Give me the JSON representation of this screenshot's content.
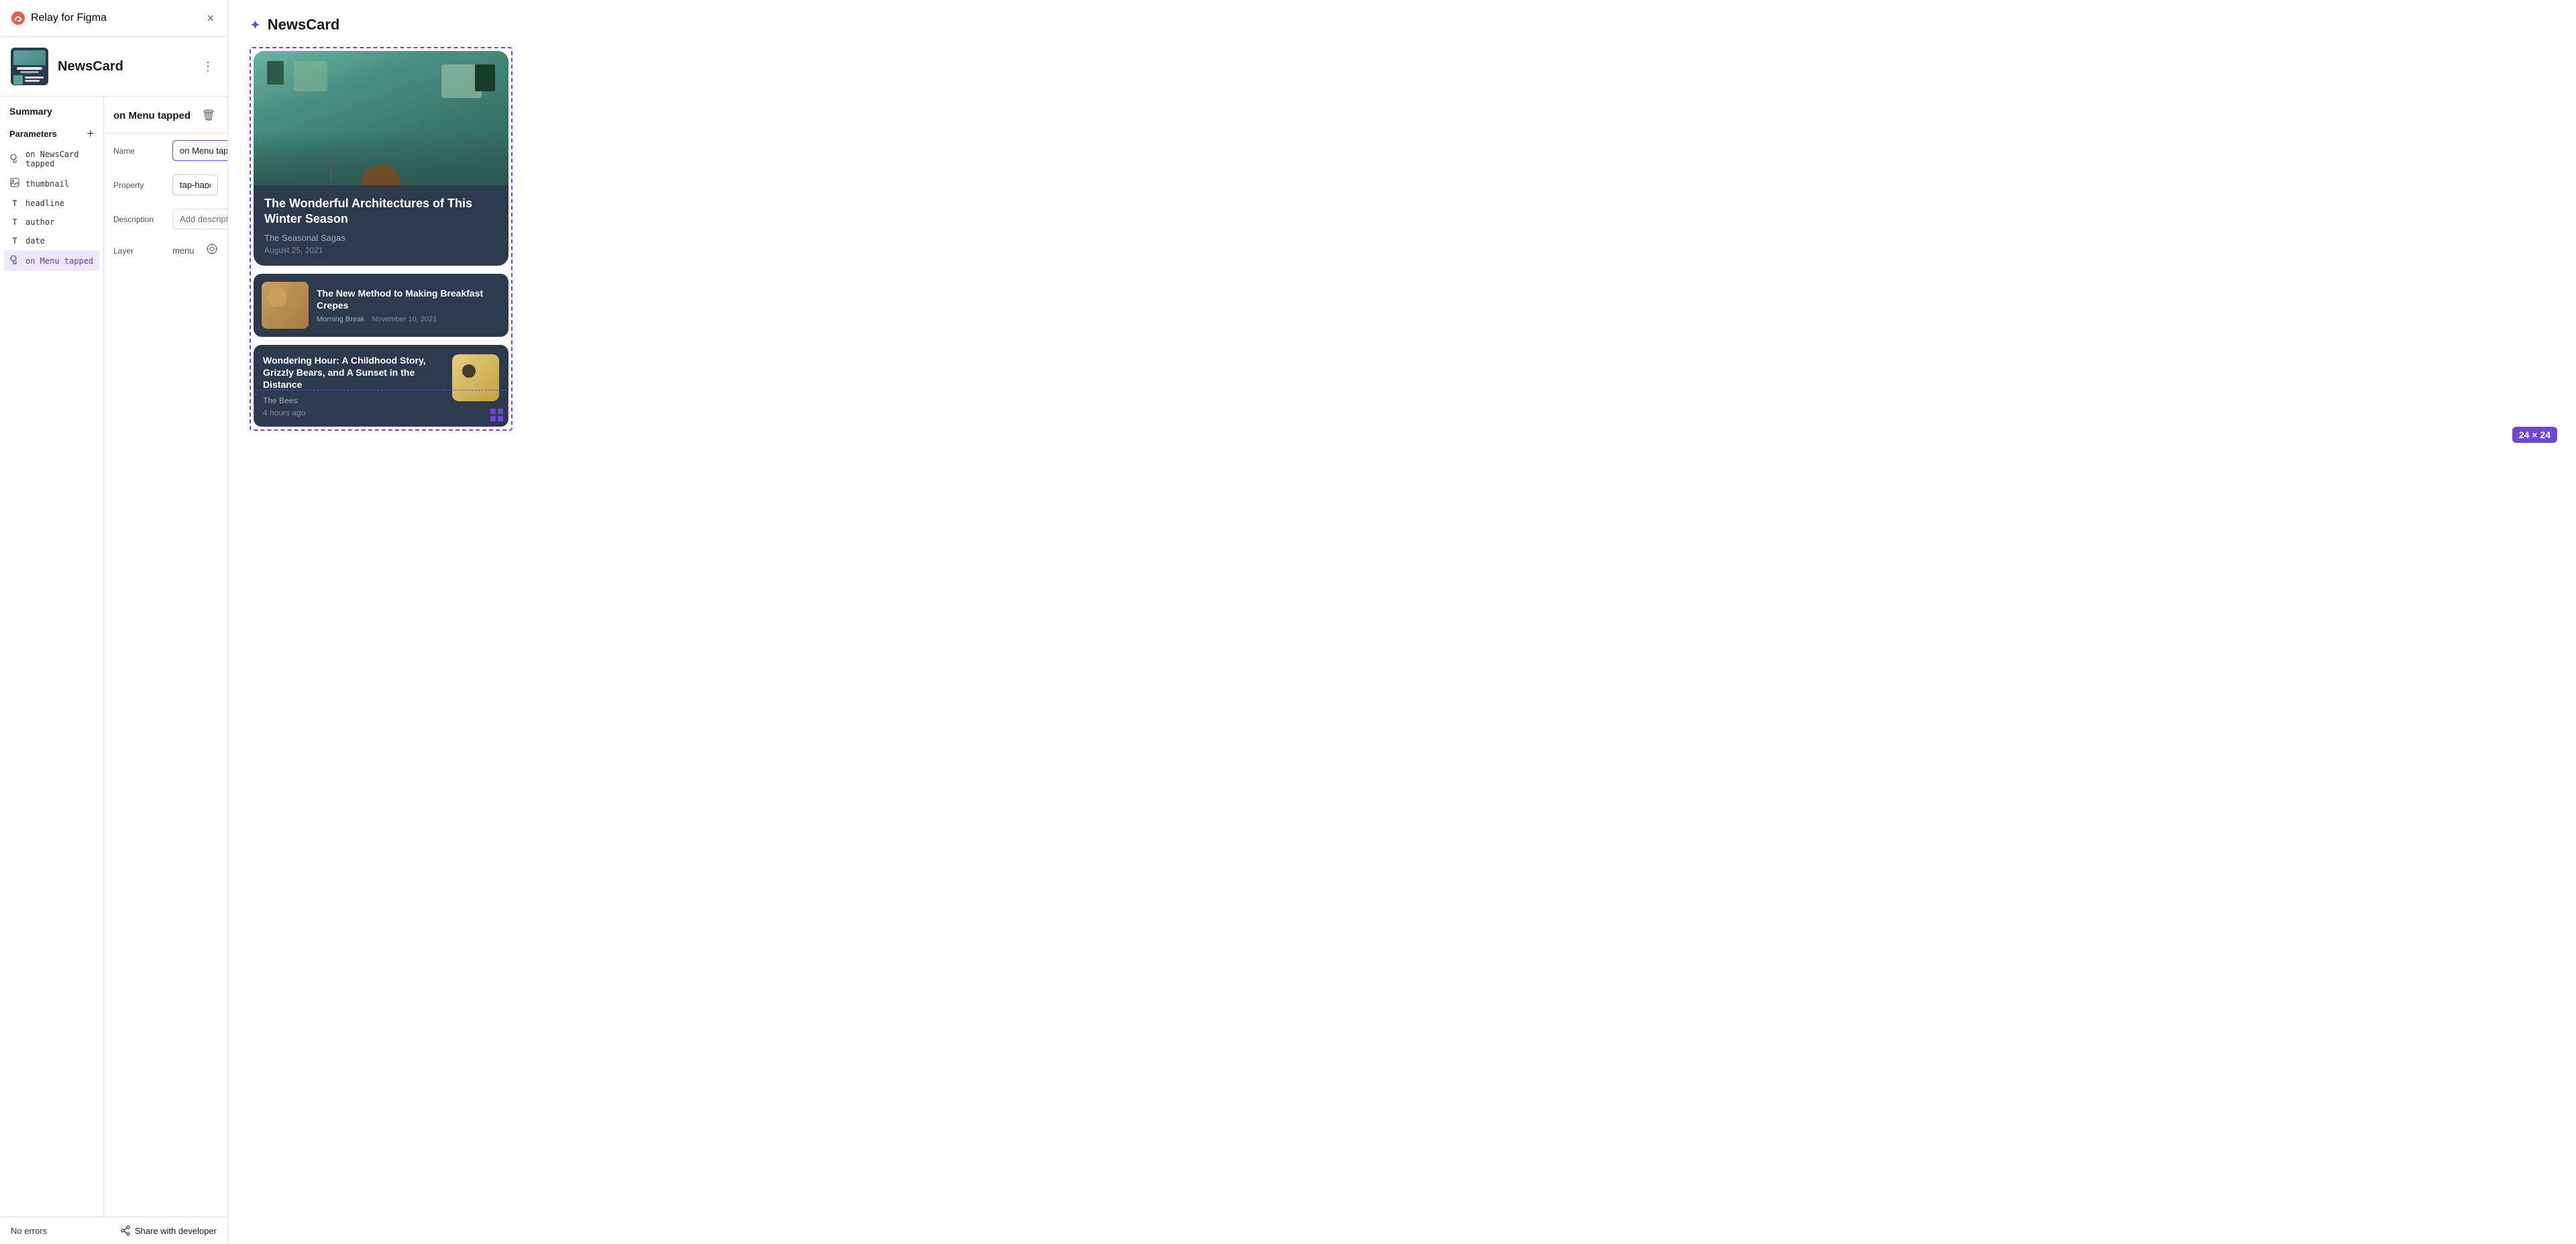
{
  "app": {
    "name": "Relay for Figma",
    "close_label": "×"
  },
  "component": {
    "title": "NewsCard",
    "more_label": "⋮"
  },
  "summary": {
    "title": "Summary",
    "parameters_label": "Parameters",
    "add_label": "+",
    "params": [
      {
        "id": "on-newscard-tapped",
        "icon": "tap",
        "name": "on NewsCard tapped",
        "active": false
      },
      {
        "id": "thumbnail",
        "icon": "image",
        "name": "thumbnail",
        "active": false
      },
      {
        "id": "headline",
        "icon": "text",
        "name": "headline",
        "active": false
      },
      {
        "id": "author",
        "icon": "text",
        "name": "author",
        "active": false
      },
      {
        "id": "date",
        "icon": "text",
        "name": "date",
        "active": false
      },
      {
        "id": "on-menu-tapped",
        "icon": "tap",
        "name": "on Menu tapped",
        "active": true
      }
    ]
  },
  "detail": {
    "title": "on Menu tapped",
    "delete_label": "🗑",
    "name_label": "Name",
    "name_value": "on Menu tapped",
    "property_label": "Property",
    "property_value": "tap-handler",
    "description_label": "Description",
    "description_placeholder": "Add description",
    "layer_label": "Layer",
    "layer_value": "menu"
  },
  "footer": {
    "no_errors": "No errors",
    "share_label": "Share with developer"
  },
  "preview": {
    "component_name": "NewsCard",
    "card1": {
      "headline": "The Wonderful Architectures of This Winter Season",
      "author": "The Seasonal Sagas",
      "date": "August 25, 2021"
    },
    "card2": {
      "headline": "The New Method to Making Breakfast Crepes",
      "author": "Morning Break",
      "date": "November 10, 2021"
    },
    "card3": {
      "headline": "Wondering Hour: A Childhood Story, Grizzly Bears, and A Sunset in the Distance",
      "author": "The Bees",
      "date": "4 hours ago"
    },
    "size_badge": "24 × 24"
  }
}
